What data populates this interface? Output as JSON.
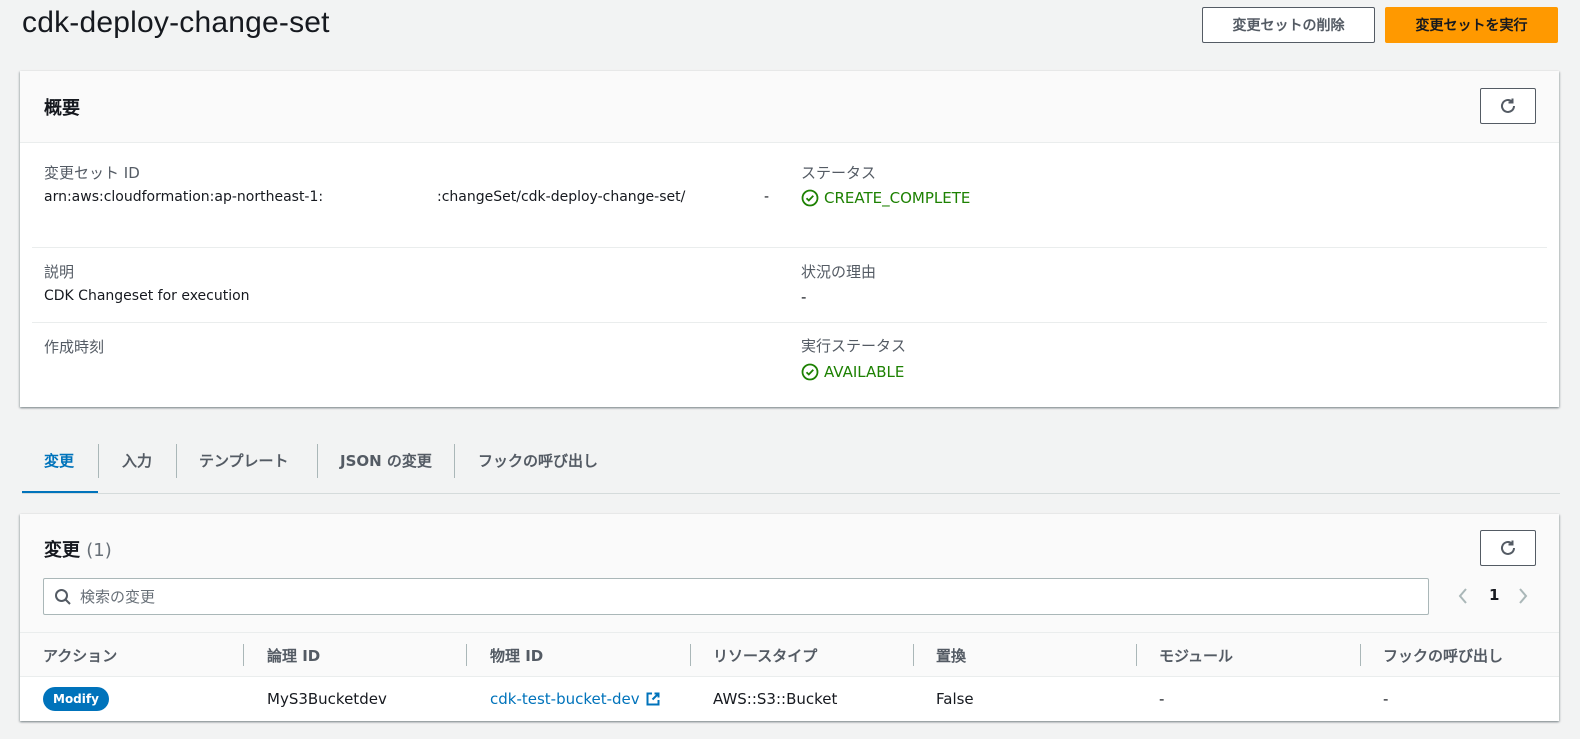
{
  "page": {
    "title": "cdk-deploy-change-set"
  },
  "actions": {
    "delete_label": "変更セットの削除",
    "execute_label": "変更セットを実行"
  },
  "overview": {
    "title": "概要",
    "changeset_id_label": "変更セット ID",
    "changeset_id_part1": "arn:aws:cloudformation:ap-northeast-1:",
    "changeset_id_part2": ":changeSet/cdk-deploy-change-set/",
    "changeset_id_part3": "-",
    "status_label": "ステータス",
    "status_value": "CREATE_COMPLETE",
    "description_label": "説明",
    "description_value": "CDK Changeset for execution",
    "reason_label": "状況の理由",
    "reason_value": "-",
    "created_label": "作成時刻",
    "exec_status_label": "実行ステータス",
    "exec_status_value": "AVAILABLE"
  },
  "tabs": [
    {
      "label": "変更"
    },
    {
      "label": "入力"
    },
    {
      "label": "テンプレート"
    },
    {
      "label": "JSON の変更"
    },
    {
      "label": "フックの呼び出し"
    }
  ],
  "changes": {
    "title": "変更",
    "count": "(1)",
    "search_placeholder": "検索の変更",
    "page_number": "1",
    "columns": [
      "アクション",
      "論理 ID",
      "物理 ID",
      "リソースタイプ",
      "置換",
      "モジュール",
      "フックの呼び出し"
    ],
    "rows": [
      {
        "action": "Modify",
        "logical_id": "MyS3Bucketdev",
        "physical_id": "cdk-test-bucket-dev",
        "resource_type": "AWS::S3::Bucket",
        "replacement": "False",
        "module": "-",
        "hooks": "-"
      }
    ]
  },
  "colors": {
    "primary": "#ff9900",
    "link": "#0073bb",
    "success": "#1d8102"
  },
  "icons": [
    "refresh-icon",
    "check-circle-icon",
    "search-icon",
    "chevron-left-icon",
    "chevron-right-icon",
    "external-link-icon"
  ]
}
